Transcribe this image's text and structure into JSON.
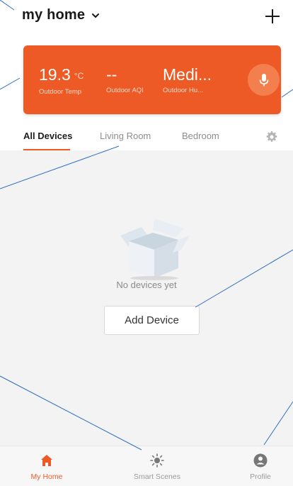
{
  "header": {
    "home_name": "my home",
    "dropdown_icon": "chevron-down-icon",
    "add_icon": "plus-icon"
  },
  "weather": {
    "temp_value": "19.3",
    "temp_unit": "°C",
    "temp_label": "Outdoor Temp",
    "aqi_value": "--",
    "aqi_label": "Outdoor AQI",
    "humidity_value": "Medi...",
    "humidity_label": "Outdoor Hu...",
    "mic_icon": "microphone-icon",
    "card_color": "#ee5a26"
  },
  "tabs": [
    {
      "label": "All Devices",
      "active": true
    },
    {
      "label": "Living Room",
      "active": false
    },
    {
      "label": "Bedroom",
      "active": false
    }
  ],
  "tabs_settings_icon": "gear-icon",
  "content": {
    "empty_text": "No devices yet",
    "add_button_label": "Add Device",
    "illustration": "empty-box-icon"
  },
  "bottom_nav": [
    {
      "label": "My Home",
      "icon": "home-icon",
      "active": true
    },
    {
      "label": "Smart Scenes",
      "icon": "sun-icon",
      "active": false
    },
    {
      "label": "Profile",
      "icon": "user-icon",
      "active": false
    }
  ],
  "colors": {
    "accent": "#ee5a26",
    "content_background": "#f3f3f3",
    "callout_line": "#2f6fbf"
  }
}
